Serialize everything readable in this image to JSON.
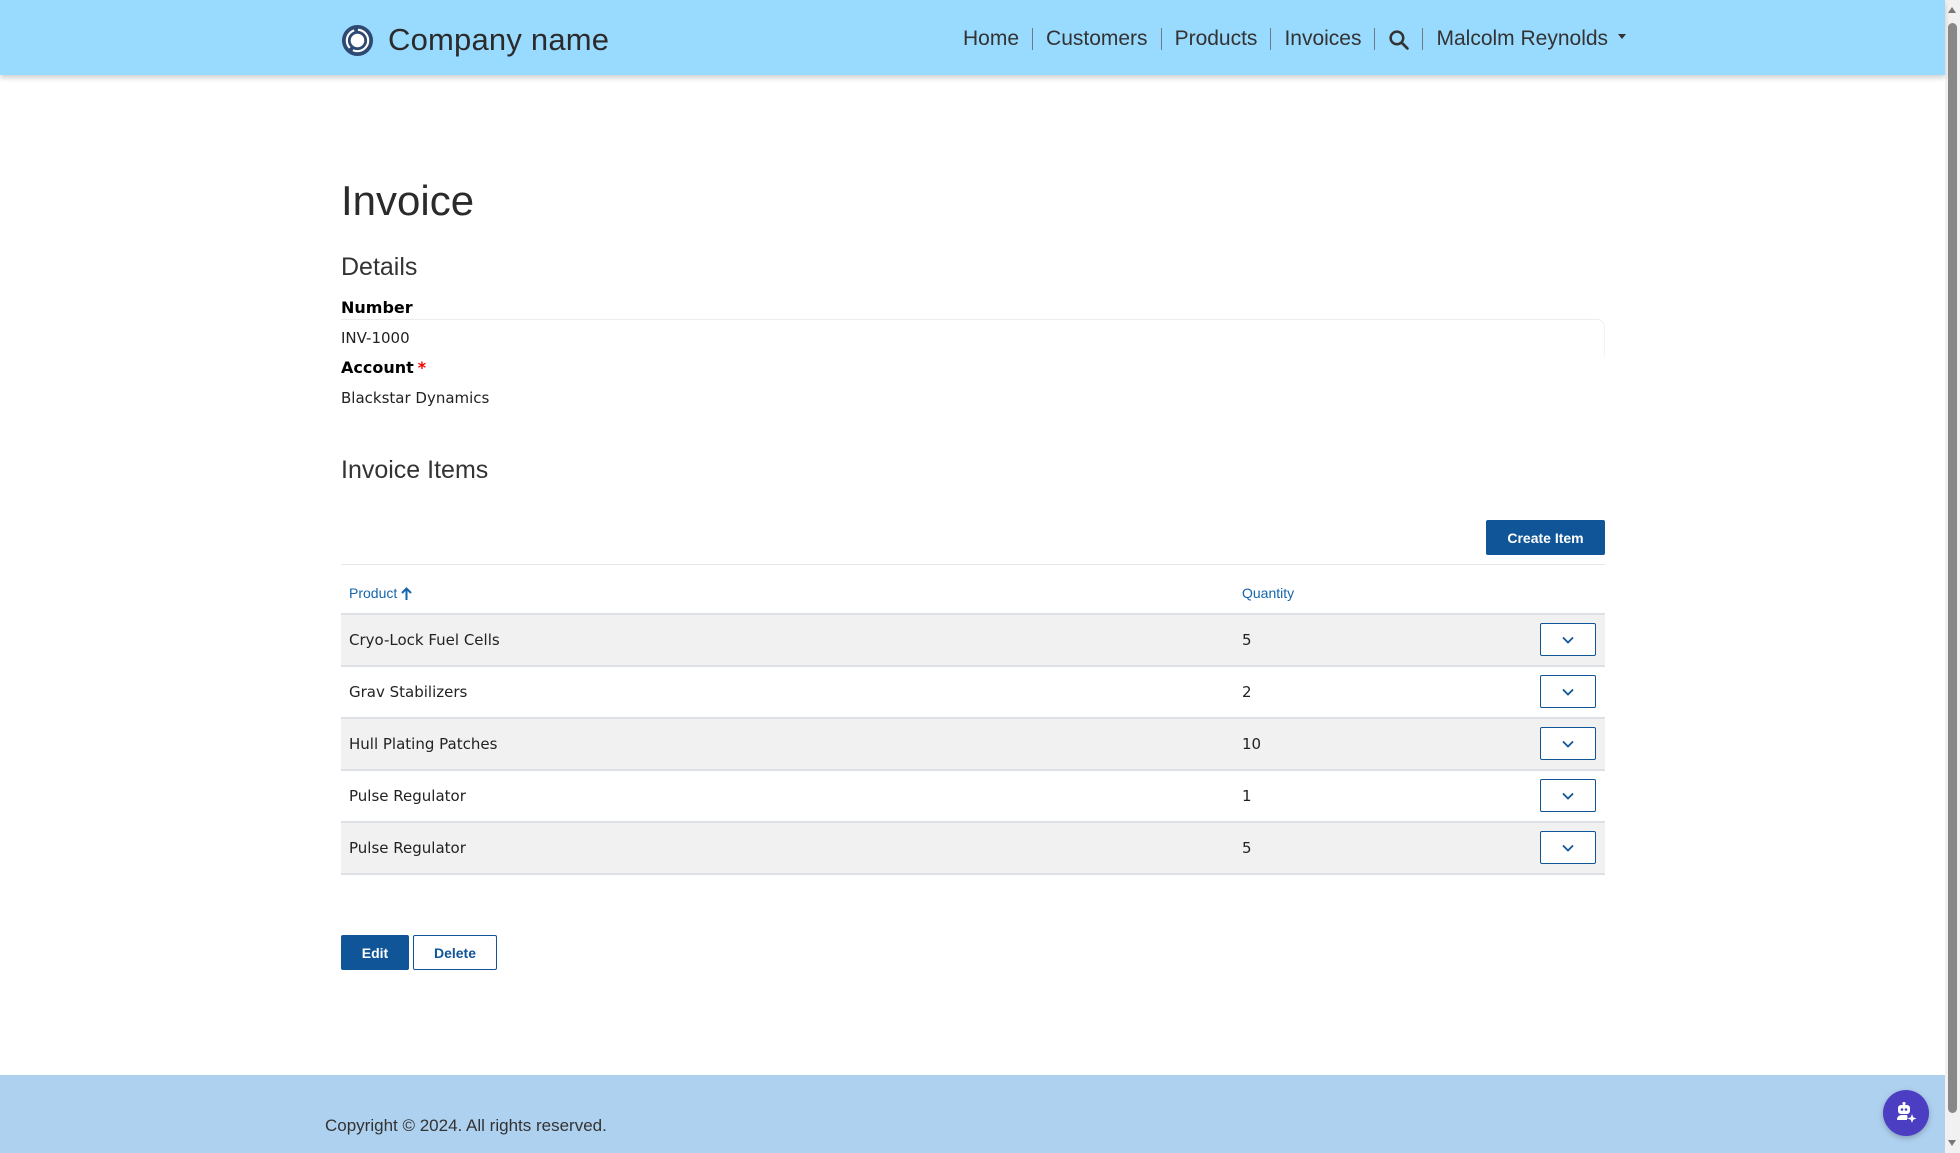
{
  "header": {
    "brand_name": "Company name",
    "logo_icon": "ring-logo-icon",
    "nav": [
      {
        "label": "Home"
      },
      {
        "label": "Customers"
      },
      {
        "label": "Products"
      },
      {
        "label": "Invoices"
      }
    ],
    "search_icon": "search-icon",
    "user_name": "Malcolm Reynolds"
  },
  "main": {
    "page_title": "Invoice",
    "details": {
      "title": "Details",
      "number_label": "Number",
      "number_value": "INV-1000",
      "account_label": "Account",
      "account_required_marker": "*",
      "account_value": "Blackstar Dynamics"
    },
    "items": {
      "title": "Invoice Items",
      "create_button": "Create Item",
      "columns": [
        {
          "label": "Product",
          "sort": "ascending"
        },
        {
          "label": "Quantity"
        }
      ],
      "rows": [
        {
          "product": "Cryo-Lock Fuel Cells",
          "quantity": "5"
        },
        {
          "product": "Grav Stabilizers",
          "quantity": "2"
        },
        {
          "product": "Hull Plating Patches",
          "quantity": "10"
        },
        {
          "product": "Pulse Regulator",
          "quantity": "1"
        },
        {
          "product": "Pulse Regulator",
          "quantity": "5"
        }
      ]
    },
    "actions": {
      "edit": "Edit",
      "delete": "Delete"
    }
  },
  "footer": {
    "copyright": "Copyright © 2024. All rights reserved."
  },
  "colors": {
    "header_bg": "#99daff",
    "footer_bg": "#afd1f0",
    "primary": "#0f5597",
    "link": "#1665ad",
    "assistant": "#4b3ec2",
    "required": "#e00000"
  }
}
